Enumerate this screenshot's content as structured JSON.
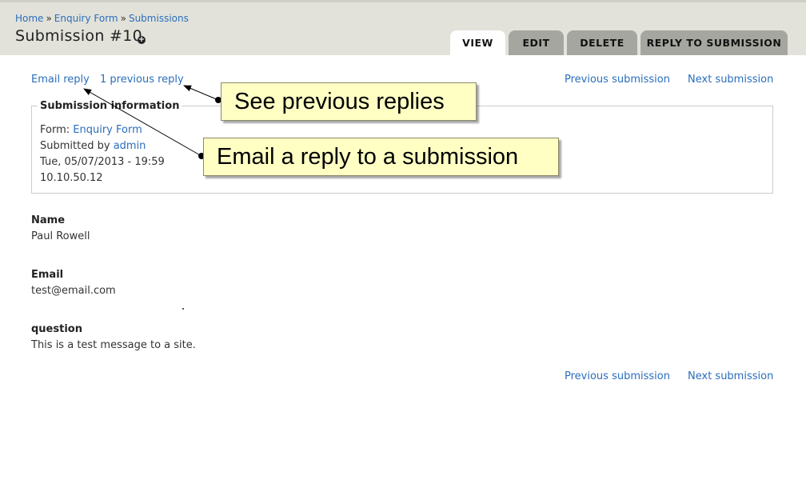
{
  "breadcrumb": {
    "items": [
      "Home",
      "Enquiry Form",
      "Submissions"
    ],
    "separator": "»"
  },
  "page": {
    "title": "Submission #10"
  },
  "tabs": [
    {
      "label": "VIEW",
      "active": true
    },
    {
      "label": "EDIT",
      "active": false
    },
    {
      "label": "DELETE",
      "active": false
    },
    {
      "label": "REPLY TO SUBMISSION",
      "active": false
    }
  ],
  "top_actions": {
    "email_reply": "Email reply",
    "previous_reply": "1 previous reply",
    "previous_submission": "Previous submission",
    "next_submission": "Next submission"
  },
  "submission_info": {
    "legend": "Submission information",
    "form_label": "Form:",
    "form_value": "Enquiry Form",
    "submitted_by_label": "Submitted by",
    "submitted_by_value": "admin",
    "date": "Tue, 05/07/2013 - 19:59",
    "ip": "10.10.50.12"
  },
  "fields": [
    {
      "label": "Name",
      "value": "Paul Rowell"
    },
    {
      "label": "Email",
      "value": "test@email.com"
    },
    {
      "label": "question",
      "value": "This is a test message to a site."
    }
  ],
  "bottom_actions": {
    "previous_submission": "Previous submission",
    "next_submission": "Next submission"
  },
  "callouts": {
    "previous_replies": "See previous replies",
    "email_reply": "Email a reply to a submission"
  },
  "colors": {
    "link": "#2a6ebb",
    "header_bg": "#e2e2da",
    "tab_inactive": "#a6a6a1",
    "callout_bg": "#ffffc4"
  }
}
